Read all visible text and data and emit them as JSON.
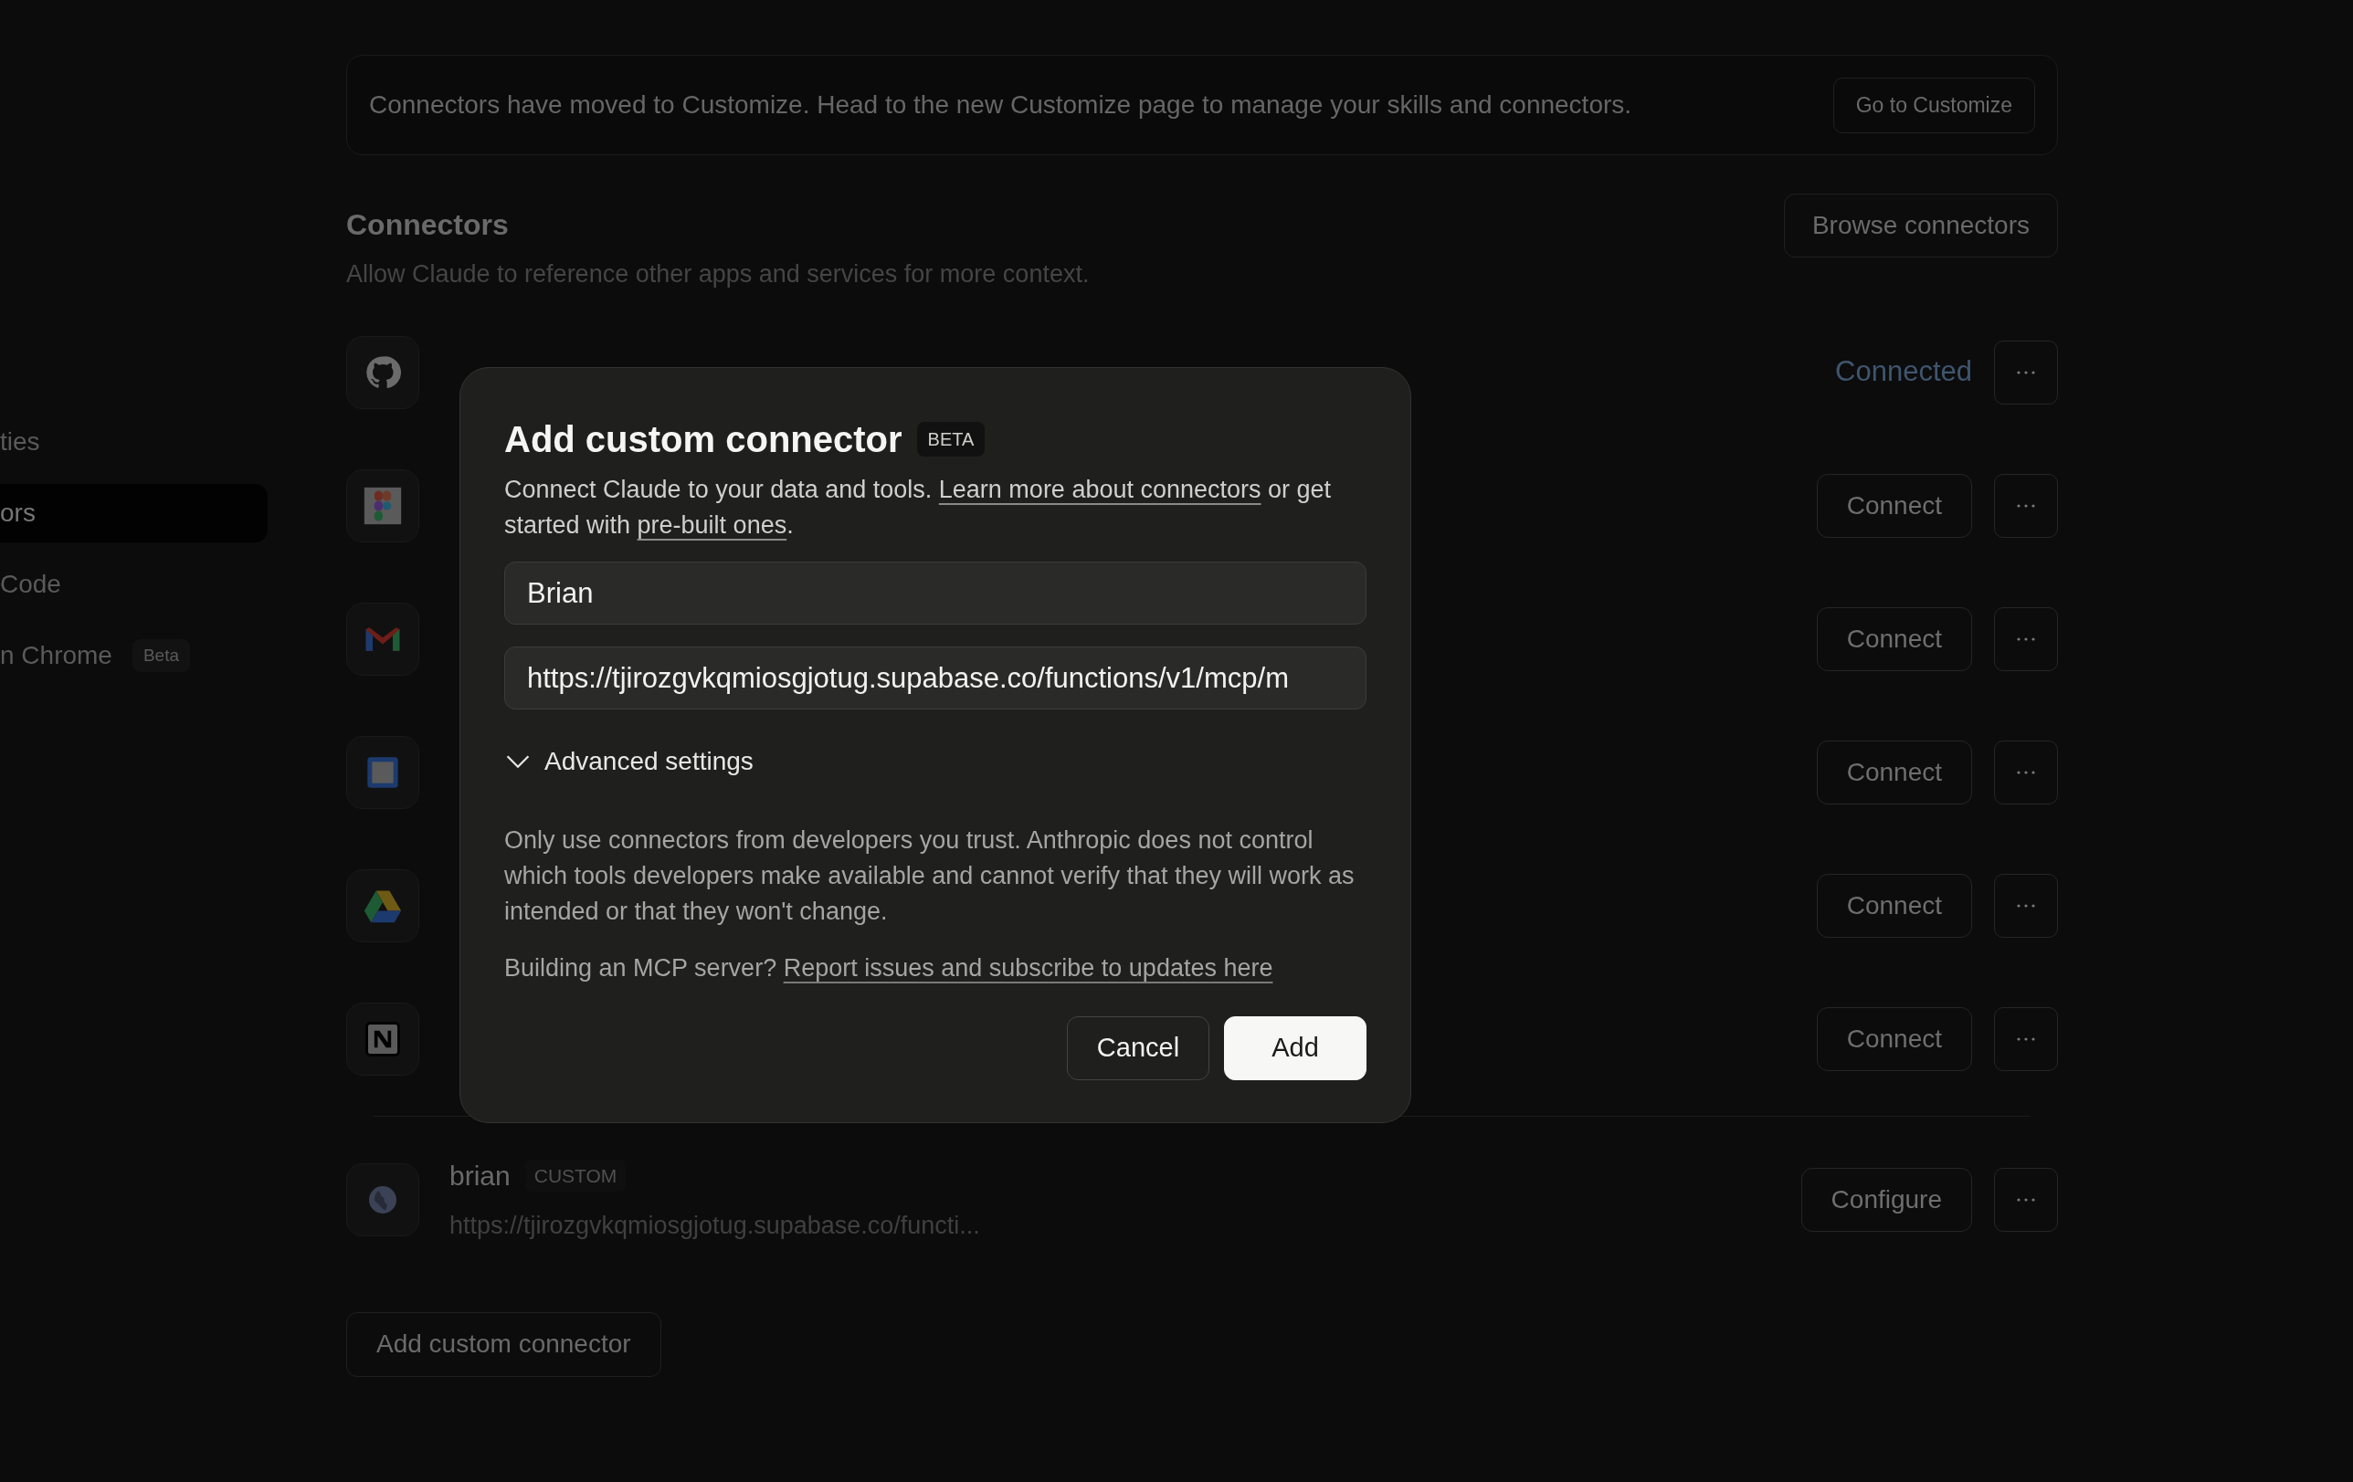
{
  "sidebar": {
    "items": [
      {
        "label": "ties",
        "selected": false
      },
      {
        "label": "ors",
        "selected": true
      },
      {
        "label": "Code",
        "selected": false
      },
      {
        "label": "n Chrome",
        "selected": false,
        "badge": "Beta"
      }
    ]
  },
  "banner": {
    "text": "Connectors have moved to Customize. Head to the new Customize page to manage your skills and connectors.",
    "button": "Go to Customize"
  },
  "section": {
    "title": "Connectors",
    "subtitle": "Allow Claude to reference other apps and services for more context.",
    "button": "Browse connectors"
  },
  "connectors": [
    {
      "kind": "github",
      "action": {
        "kind": "status",
        "label": "Connected"
      }
    },
    {
      "kind": "figma",
      "action": {
        "kind": "button",
        "label": "Connect"
      }
    },
    {
      "kind": "gmail",
      "action": {
        "kind": "button",
        "label": "Connect"
      }
    },
    {
      "kind": "calendar",
      "action": {
        "kind": "button",
        "label": "Connect"
      }
    },
    {
      "kind": "drive",
      "action": {
        "kind": "button",
        "label": "Connect"
      }
    },
    {
      "kind": "notion",
      "action": {
        "kind": "button",
        "label": "Connect"
      }
    }
  ],
  "custom_connectors": [
    {
      "name": "brian",
      "tag": "CUSTOM",
      "url": "https://tjirozgvkqmiosgjotug.supabase.co/functi...",
      "action": {
        "kind": "button",
        "label": "Configure"
      }
    }
  ],
  "add_button": "Add custom connector",
  "dialog": {
    "title": "Add custom connector",
    "badge": "BETA",
    "description": [
      {
        "kind": "text",
        "text": "Connect Claude to your data and tools. "
      },
      {
        "kind": "link",
        "text": "Learn more about connectors"
      },
      {
        "kind": "text",
        "text": " or get started with "
      },
      {
        "kind": "link",
        "text": "pre-built ones"
      },
      {
        "kind": "text",
        "text": "."
      }
    ],
    "name_field": {
      "value": "Brian"
    },
    "url_field": {
      "value": "https://tjirozgvkqmiosgjotug.supabase.co/functions/v1/mcp/m"
    },
    "advanced": {
      "label": "Advanced settings",
      "expanded": false
    },
    "warning": "Only use connectors from developers you trust. Anthropic does not control which tools developers make available and cannot verify that they will work as intended or that they won't change.",
    "mcp_note": "Building an MCP server?",
    "mcp_link": "Report issues and subscribe to updates here",
    "buttons": [
      {
        "kind": "secondary",
        "label": "Cancel"
      },
      {
        "kind": "primary",
        "label": "Add"
      }
    ]
  }
}
